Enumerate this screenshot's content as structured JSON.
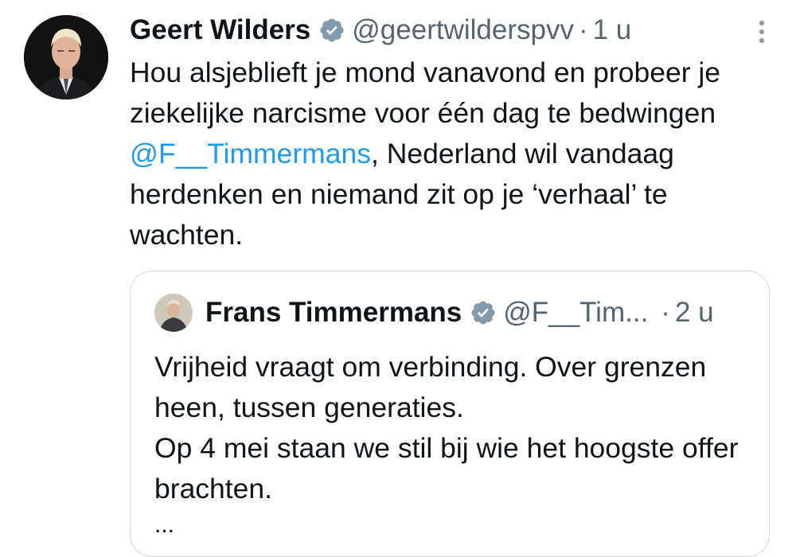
{
  "tweet": {
    "author_name": "Geert Wilders",
    "handle": "@geertwilderspvv",
    "separator": "·",
    "time": "1 u",
    "text_before": "Hou alsjeblieft je mond vanavond en probeer je ziekelijke narcisme voor één dag te bedwingen ",
    "mention": "@F__Timmermans",
    "text_after": ", Nederland wil vandaag herdenken en niemand zit op je ‘verhaal’ te wachten."
  },
  "quoted_tweet": {
    "author_name": "Frans Timmermans",
    "handle": "@F__Tim...",
    "separator": "·",
    "time": "2 u",
    "line1": "Vrijheid vraagt om verbinding. Over grenzen heen, tussen generaties.",
    "line2": "Op 4 mei staan we stil bij wie het hoogste offer brachten.",
    "truncation": "..."
  },
  "colors": {
    "text": "#0f1419",
    "secondary": "#536471",
    "link": "#1d9bf0",
    "verified_badge": "#829aab",
    "border": "#cfd9de"
  },
  "icons": {
    "verified": "verified-badge-icon",
    "more": "more-options-icon"
  }
}
